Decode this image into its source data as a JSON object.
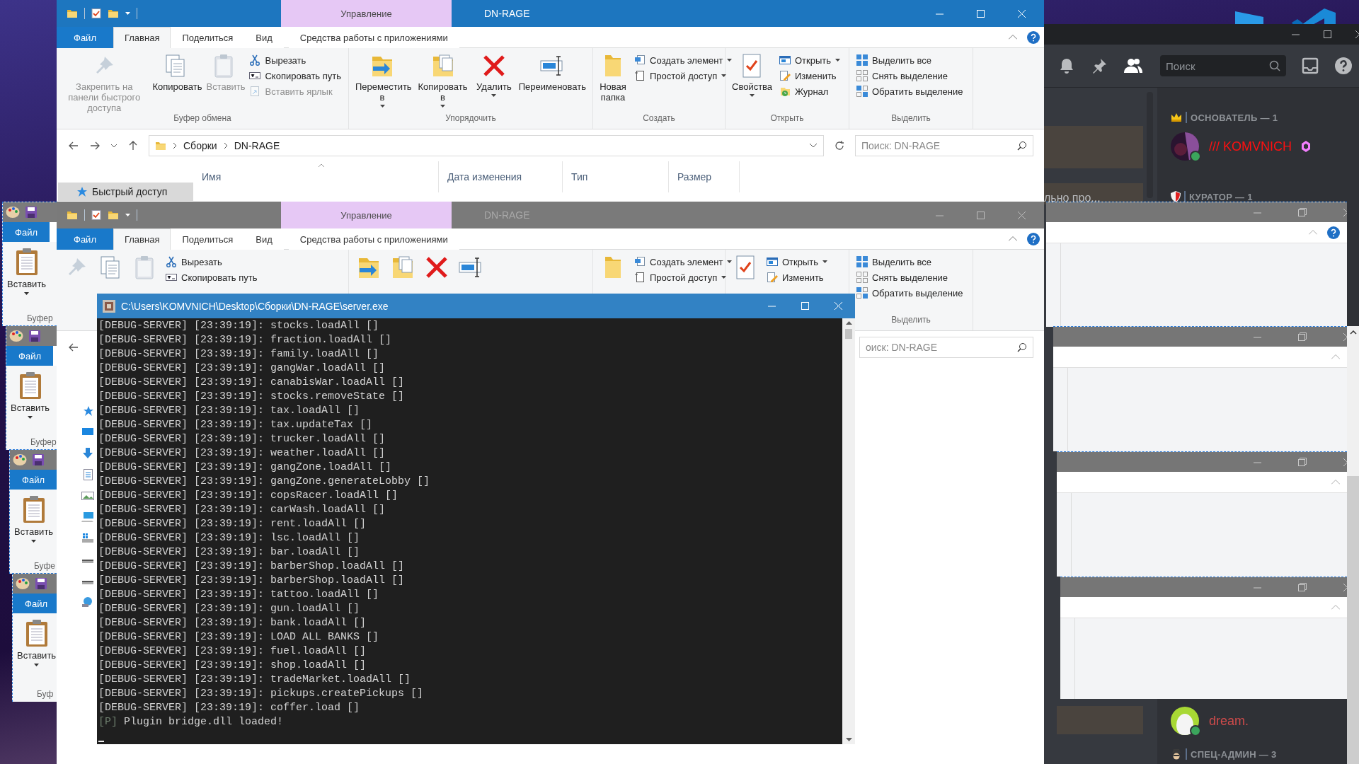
{
  "paint_windows": [
    {
      "file_tab": "Файл",
      "paste_label": "Вставить",
      "group_label": "Буфер"
    },
    {
      "file_tab": "Файл",
      "paste_label": "Вставить",
      "group_label": "Буфер"
    },
    {
      "file_tab": "Файл",
      "paste_label": "Вставить",
      "group_label": "Буфе"
    },
    {
      "file_tab": "Файл",
      "paste_label": "Вставить",
      "group_label": "Буф"
    }
  ],
  "discord": {
    "search_placeholder": "Поиск",
    "chat_preview": "льно про...",
    "groups": [
      {
        "title": "ОСНОВАТЕЛЬ — 1",
        "members": [
          {
            "name": "/// KOMVNICH",
            "color": "#ff1010",
            "online": true
          }
        ]
      },
      {
        "title": "КУРАТОР — 1"
      }
    ],
    "bottom_member": {
      "name": "dream.",
      "color": "#cf4b4b",
      "online": true
    },
    "bottom_group": {
      "title": "СПЕЦ-АДМИН — 3"
    }
  },
  "explorer_windows": [
    {
      "active": true,
      "title": "DN-RAGE",
      "context_header": "Управление",
      "tabs": [
        {
          "label": "Файл",
          "kind": "file",
          "selected": false
        },
        {
          "label": "Главная",
          "kind": "normal",
          "selected": true
        },
        {
          "label": "Поделиться",
          "kind": "normal",
          "selected": false
        },
        {
          "label": "Вид",
          "kind": "normal",
          "selected": false
        },
        {
          "label": "Средства работы с приложениями",
          "kind": "context",
          "selected": false
        }
      ],
      "ribbon": [
        {
          "label": "Буфер обмена",
          "big": [
            {
              "label": "Закрепить на панели быстрого доступа",
              "disabled": true,
              "dropdown": false
            },
            {
              "label": "Копировать",
              "disabled": false,
              "dropdown": false
            },
            {
              "label": "Вставить",
              "disabled": true,
              "dropdown": false
            }
          ],
          "small": [
            {
              "label": "Вырезать",
              "disabled": false,
              "dropdown": false
            },
            {
              "label": "Скопировать путь",
              "disabled": false,
              "dropdown": false
            },
            {
              "label": "Вставить ярлык",
              "disabled": true,
              "dropdown": false
            }
          ]
        },
        {
          "label": "Упорядочить",
          "big": [
            {
              "label": "Переместить в",
              "disabled": false,
              "dropdown": true
            },
            {
              "label": "Копировать в",
              "disabled": false,
              "dropdown": true
            },
            {
              "label": "Удалить",
              "disabled": false,
              "dropdown": true
            },
            {
              "label": "Переименовать",
              "disabled": false,
              "dropdown": false
            }
          ]
        },
        {
          "label": "Создать",
          "big": [
            {
              "label": "Новая папка",
              "disabled": false,
              "dropdown": false
            }
          ],
          "small": [
            {
              "label": "Создать элемент",
              "disabled": false,
              "dropdown": true
            },
            {
              "label": "Простой доступ",
              "disabled": false,
              "dropdown": true
            }
          ]
        },
        {
          "label": "Открыть",
          "big": [
            {
              "label": "Свойства",
              "disabled": false,
              "dropdown": true
            }
          ],
          "small": [
            {
              "label": "Открыть",
              "disabled": false,
              "dropdown": true
            },
            {
              "label": "Изменить",
              "disabled": false,
              "dropdown": false
            },
            {
              "label": "Журнал",
              "disabled": false,
              "dropdown": false
            }
          ]
        },
        {
          "label": "Выделить",
          "small": [
            {
              "label": "Выделить все",
              "disabled": false,
              "dropdown": false
            },
            {
              "label": "Снять выделение",
              "disabled": false,
              "dropdown": false
            },
            {
              "label": "Обратить выделение",
              "disabled": false,
              "dropdown": false
            }
          ]
        }
      ],
      "path": [
        "Сборки",
        "DN-RAGE"
      ],
      "search_placeholder": "Поиск: DN-RAGE",
      "nav_items": [
        {
          "label": "Быстрый доступ",
          "selected": true
        }
      ],
      "columns": [
        "Имя",
        "Дата изменения",
        "Тип",
        "Размер"
      ]
    },
    {
      "active": false,
      "title": "DN-RAGE",
      "context_header": "Управление",
      "tabs": [
        {
          "label": "Файл",
          "kind": "file",
          "selected": false
        },
        {
          "label": "Главная",
          "kind": "normal",
          "selected": true
        },
        {
          "label": "Поделиться",
          "kind": "normal",
          "selected": false
        },
        {
          "label": "Вид",
          "kind": "normal",
          "selected": false
        },
        {
          "label": "Средства работы с приложениями",
          "kind": "context",
          "selected": false
        }
      ],
      "ribbon": [
        {
          "big": [
            {
              "disabled": true
            },
            {
              "disabled": false
            },
            {
              "disabled": true
            }
          ],
          "small": [
            {
              "label": "Вырезать",
              "disabled": false,
              "dropdown": false
            },
            {
              "label": "Скопировать путь",
              "disabled": false,
              "dropdown": false
            }
          ]
        },
        {
          "big": [
            {
              "disabled": false
            },
            {
              "disabled": false
            },
            {
              "disabled": false
            },
            {
              "disabled": false
            }
          ]
        },
        {
          "big": [
            {
              "disabled": false
            }
          ],
          "small": [
            {
              "label": "Создать элемент",
              "disabled": false,
              "dropdown": true
            },
            {
              "label": "Простой доступ",
              "disabled": false,
              "dropdown": true
            }
          ]
        },
        {
          "big": [
            {
              "disabled": false
            }
          ],
          "small": [
            {
              "label": "Открыть",
              "disabled": false,
              "dropdown": true
            },
            {
              "label": "Изменить",
              "disabled": false,
              "dropdown": false
            }
          ]
        },
        {
          "label": "Выделить",
          "small": [
            {
              "label": "Выделить все",
              "disabled": false,
              "dropdown": false
            },
            {
              "label": "Снять выделение",
              "disabled": false,
              "dropdown": false
            },
            {
              "label": "Обратить выделение",
              "disabled": false,
              "dropdown": false
            }
          ]
        }
      ],
      "search_placeholder": "оиск: DN-RAGE"
    }
  ],
  "console": {
    "title": "C:\\Users\\KOMVNICH\\Desktop\\Сборки\\DN-RAGE\\server.exe",
    "lines": [
      {
        "text": "[DEBUG-SERVER] [23:39:19]: stocks.loadAll []"
      },
      {
        "text": "[DEBUG-SERVER] [23:39:19]: fraction.loadAll []"
      },
      {
        "text": "[DEBUG-SERVER] [23:39:19]: family.loadAll []"
      },
      {
        "text": "[DEBUG-SERVER] [23:39:19]: gangWar.loadAll []"
      },
      {
        "text": "[DEBUG-SERVER] [23:39:19]: canabisWar.loadAll []"
      },
      {
        "text": "[DEBUG-SERVER] [23:39:19]: stocks.removeState []"
      },
      {
        "text": "[DEBUG-SERVER] [23:39:19]: tax.loadAll []"
      },
      {
        "text": "[DEBUG-SERVER] [23:39:19]: tax.updateTax []"
      },
      {
        "text": "[DEBUG-SERVER] [23:39:19]: trucker.loadAll []"
      },
      {
        "text": "[DEBUG-SERVER] [23:39:19]: weather.loadAll []"
      },
      {
        "text": "[DEBUG-SERVER] [23:39:19]: gangZone.loadAll []"
      },
      {
        "text": "[DEBUG-SERVER] [23:39:19]: gangZone.generateLobby []"
      },
      {
        "text": "[DEBUG-SERVER] [23:39:19]: copsRacer.loadAll []"
      },
      {
        "text": "[DEBUG-SERVER] [23:39:19]: carWash.loadAll []"
      },
      {
        "text": "[DEBUG-SERVER] [23:39:19]: rent.loadAll []"
      },
      {
        "text": "[DEBUG-SERVER] [23:39:19]: lsc.loadAll []"
      },
      {
        "text": "[DEBUG-SERVER] [23:39:19]: bar.loadAll []"
      },
      {
        "text": "[DEBUG-SERVER] [23:39:19]: barberShop.loadAll []"
      },
      {
        "text": "[DEBUG-SERVER] [23:39:19]: barberShop.loadAll []"
      },
      {
        "text": "[DEBUG-SERVER] [23:39:19]: tattoo.loadAll []"
      },
      {
        "text": "[DEBUG-SERVER] [23:39:19]: gun.loadAll []"
      },
      {
        "text": "[DEBUG-SERVER] [23:39:19]: bank.loadAll []"
      },
      {
        "text": "[DEBUG-SERVER] [23:39:19]: LOAD ALL BANKS []"
      },
      {
        "text": "[DEBUG-SERVER] [23:39:19]: fuel.loadAll []"
      },
      {
        "text": "[DEBUG-SERVER] [23:39:19]: shop.loadAll []"
      },
      {
        "text": "[DEBUG-SERVER] [23:39:19]: tradeMarket.loadAll []"
      },
      {
        "text": "[DEBUG-SERVER] [23:39:19]: pickups.createPickups []"
      },
      {
        "text": "[DEBUG-SERVER] [23:39:19]: coffer.load []"
      },
      {
        "prefix": "[P]",
        "text": "Plugin bridge.dll loaded!"
      }
    ]
  }
}
